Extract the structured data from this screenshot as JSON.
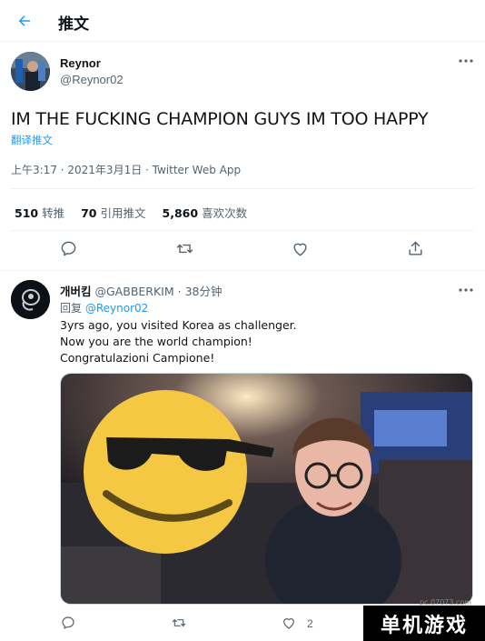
{
  "header": {
    "title": "推文",
    "back_icon": "arrow-left-icon"
  },
  "tweet": {
    "author_name": "Reynor",
    "author_handle": "@Reynor02",
    "text": "IM THE FUCKING CHAMPION GUYS IM TOO HAPPY",
    "translate_label": "翻译推文",
    "timestamp": "上午3:17 · 2021年3月1日 · Twitter Web App",
    "stats": [
      {
        "count": "510",
        "label": "转推"
      },
      {
        "count": "70",
        "label": "引用推文"
      },
      {
        "count": "5,860",
        "label": "喜欢次数"
      }
    ],
    "actions": [
      "reply-icon",
      "retweet-icon",
      "like-icon",
      "share-icon"
    ]
  },
  "reply": {
    "author_name": "개버킴",
    "author_handle": "@GABBERKIM",
    "separator": "·",
    "time": "38分钟",
    "replying_label": "回复",
    "replying_to": "@Reynor02",
    "lines": [
      "3yrs ago, you visited Korea as challenger.",
      "Now you are the world champion!",
      "Congratulazioni Campione!"
    ],
    "like_count": "2"
  },
  "watermark": {
    "text": "单机游戏",
    "site": "pc.07073.com"
  },
  "colors": {
    "accent": "#1d9bf0",
    "text": "#0f1419",
    "secondary": "#536471",
    "border": "#eff3f4"
  }
}
